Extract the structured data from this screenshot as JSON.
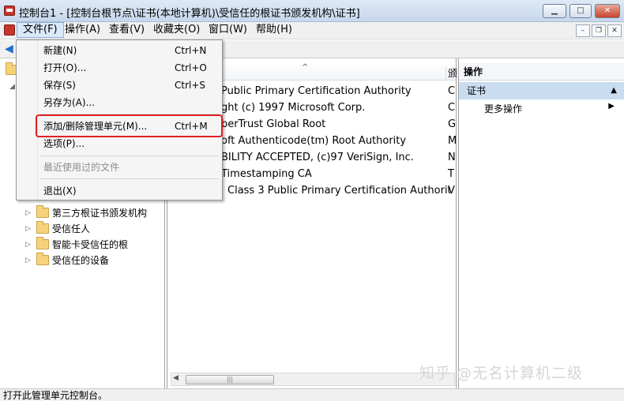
{
  "window": {
    "title": "控制台1 - [控制台根节点\\证书(本地计算机)\\受信任的根证书颁发机构\\证书]",
    "minimize_glyph": "▁",
    "maximize_glyph": "□",
    "close_glyph": "✕"
  },
  "menubar": {
    "items": [
      "文件(F)",
      "操作(A)",
      "查看(V)",
      "收藏夹(O)",
      "窗口(W)",
      "帮助(H)"
    ],
    "mdi_buttons": [
      "–",
      "❐",
      "✕"
    ]
  },
  "file_menu": {
    "items": [
      {
        "label": "新建(N)",
        "shortcut": "Ctrl+N"
      },
      {
        "label": "打开(O)...",
        "shortcut": "Ctrl+O"
      },
      {
        "label": "保存(S)",
        "shortcut": "Ctrl+S"
      },
      {
        "label": "另存为(A)...",
        "shortcut": ""
      },
      {
        "label": "添加/删除管理单元(M)...",
        "shortcut": "Ctrl+M"
      },
      {
        "label": "选项(P)...",
        "shortcut": ""
      },
      {
        "label": "最近使用过的文件",
        "shortcut": "",
        "disabled": true
      },
      {
        "label": "退出(X)",
        "shortcut": ""
      }
    ],
    "highlighted_item": "添加/删除管理单元(M)...",
    "highlight_color": "#e02020"
  },
  "tree": {
    "items": [
      "第三方根证书颁发机构",
      "受信任人",
      "智能卡受信任的根",
      "受信任的设备"
    ],
    "folder_color": "#f6d37a"
  },
  "list": {
    "header_col2": "颁",
    "rows": [
      {
        "issued": "Public Primary Certification Authority",
        "col2": "C"
      },
      {
        "issued": "ght (c) 1997 Microsoft Corp.",
        "col2": "C"
      },
      {
        "issued": "berTrust Global Root",
        "col2": "G"
      },
      {
        "issued": "oft Authenticode(tm) Root Authority",
        "col2": "M"
      },
      {
        "issued": "BILITY ACCEPTED, (c)97 VeriSign, Inc.",
        "col2": "N"
      },
      {
        "issued": "Timestamping CA",
        "col2": "T"
      },
      {
        "issued": "Class 3 Public Primary Certification Authority ...",
        "col2": "V"
      }
    ]
  },
  "actions": {
    "title": "操作",
    "section": "证书",
    "more": "更多操作"
  },
  "watermark": "知乎 @无名计算机二级",
  "statusbar": {
    "text": "打开此管理单元控制台。"
  }
}
